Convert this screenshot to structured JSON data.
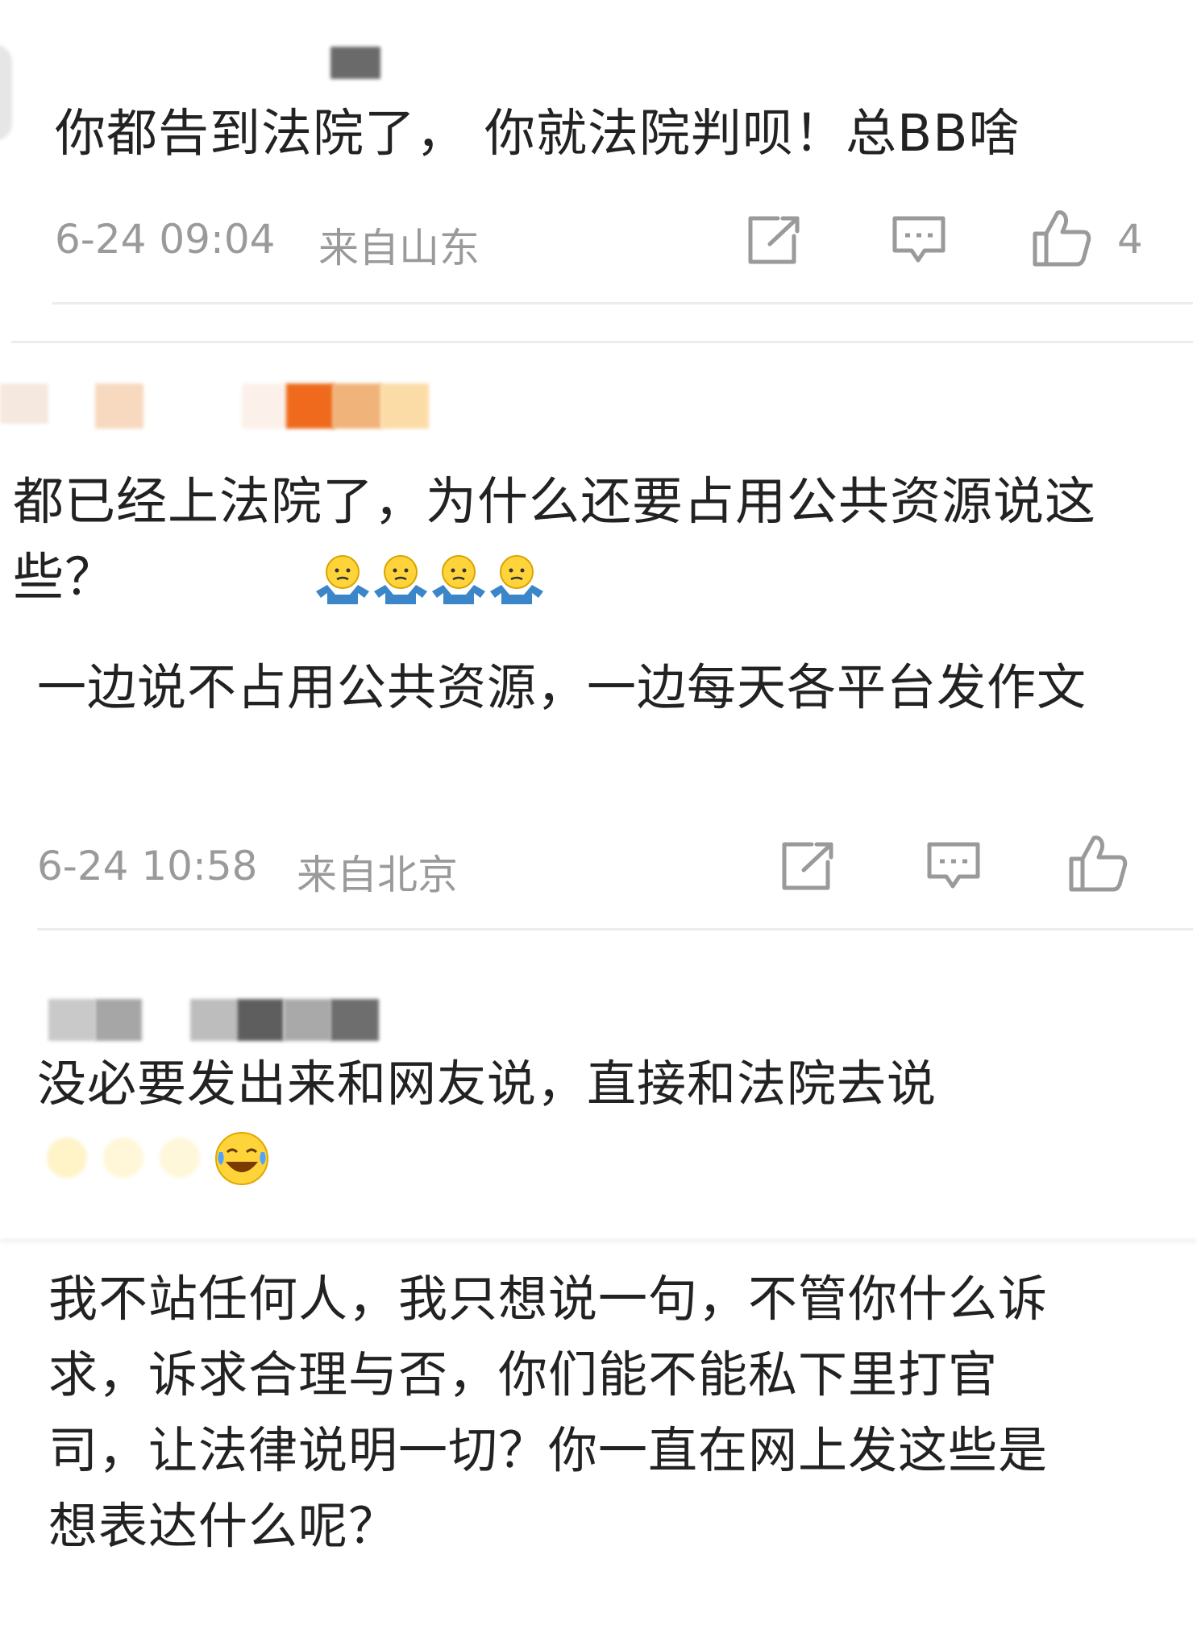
{
  "comments": [
    {
      "text": "你都告到法院了， 你就法院判呗！总BB啥",
      "time": "6-24 09:04",
      "location": "来自山东",
      "likes": "4"
    },
    {
      "text": "都已经上法院了，为什么还要占用公共资源说这些？",
      "reply_text": "一边说不占用公共资源，一边每天各平台发作文",
      "time": "6-24 10:58",
      "location": "来自北京",
      "emoji": "shrug-emoji"
    },
    {
      "text": "没必要发出来和网友说，直接和法院去说",
      "emoji": "laugh-cry-emoji"
    },
    {
      "text": "我不站任何人，我只想说一句，不管你什么诉求，诉求合理与否，你们能不能私下里打官司，让法律说明一切？你一直在网上发这些是想表达什么呢？"
    }
  ],
  "icons": [
    "share-icon",
    "comment-icon",
    "like-icon"
  ],
  "colors": {
    "text": "#222222",
    "meta": "#9a9a9a",
    "divider": "#ececec",
    "accent": "#f07a1a"
  }
}
